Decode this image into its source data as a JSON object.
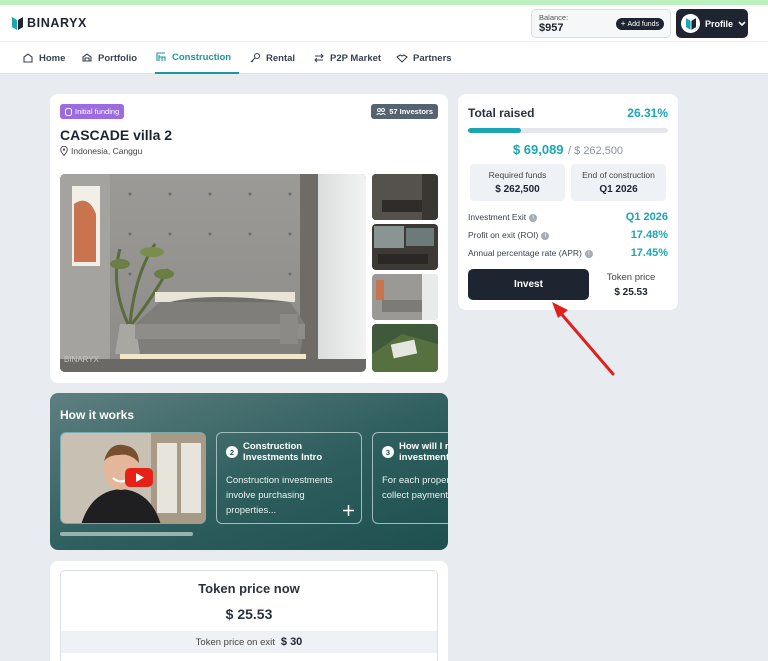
{
  "header": {
    "logo_text": "BINARYX",
    "balance_label": "Balance:",
    "balance_value": "$957",
    "add_funds_label": "Add funds",
    "profile_label": "Profile"
  },
  "nav": {
    "items": [
      {
        "label": "Home",
        "icon": "home-icon"
      },
      {
        "label": "Portfolio",
        "icon": "portfolio-icon"
      },
      {
        "label": "Construction",
        "icon": "construction-icon",
        "active": true
      },
      {
        "label": "Rental",
        "icon": "key-icon"
      },
      {
        "label": "P2P Market",
        "icon": "swap-icon"
      },
      {
        "label": "Partners",
        "icon": "handshake-icon"
      }
    ]
  },
  "property": {
    "badge_funding": "Initial funding",
    "badge_investors": "57 Investors",
    "title": "CASCADE villa 2",
    "location": "Indonesia, Canggu",
    "photo_watermark": "BINARYX"
  },
  "how_it_works": {
    "title": "How it works",
    "steps": [
      {
        "number": "2",
        "title": "Construction Investments Intro",
        "text": "Construction investments involve purchasing properties..."
      },
      {
        "number": "3",
        "title": "How will I receive my investment",
        "text": "For each property, investors collect payment to s"
      }
    ]
  },
  "token": {
    "now_label": "Token price now",
    "now_value": "$ 25.53",
    "exit_label": "Token price on exit",
    "exit_value": "$ 30"
  },
  "funding": {
    "total_raised_label": "Total raised",
    "total_raised_percent": "26.31%",
    "progress": 0.2631,
    "raised_amount": "$ 69,089",
    "target_amount": "/ $ 262,500",
    "required_label": "Required funds",
    "required_value": "$ 262,500",
    "end_label": "End of construction",
    "end_value": "Q1 2026",
    "exit_label": "Investment Exit",
    "exit_value": "Q1 2026",
    "roi_label": "Profit on exit (ROI)",
    "roi_value": "17.48%",
    "apr_label": "Annual percentage rate (APR)",
    "apr_value": "17.45%",
    "invest_label": "Invest",
    "token_price_label": "Token price",
    "token_price_value": "$ 25.53"
  },
  "colors": {
    "accent": "#1aa6b3",
    "dark": "#1e2530",
    "funding_badge": "#9b6bdf",
    "arrow": "#e0201c"
  }
}
